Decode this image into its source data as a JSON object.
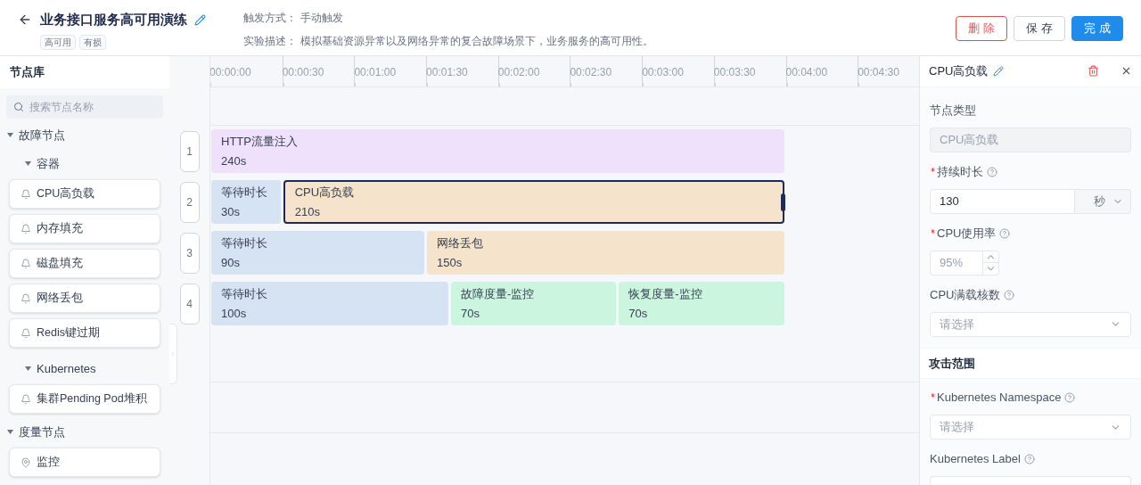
{
  "header": {
    "title": "业务接口服务高可用演练",
    "tags": [
      "高可用",
      "有损"
    ],
    "trigger_label": "触发方式：",
    "trigger": "手动触发",
    "desc_label": "实验描述：",
    "desc": "模拟基础资源异常以及网络异常的复合故障场景下，业务服务的高可用性。",
    "buttons": [
      {
        "label": "删 除",
        "kind": "danger"
      },
      {
        "label": "保 存",
        "kind": "default"
      },
      {
        "label": "完 成",
        "kind": "primary"
      }
    ]
  },
  "library": {
    "title": "节点库",
    "search": {
      "placeholder": "搜索节点名称"
    },
    "groups": [
      {
        "label": "故障节点",
        "expanded": true,
        "children": [
          {
            "label": "容器",
            "expanded": true,
            "children": [
              {
                "label": "CPU高负载",
                "kind": "fault"
              },
              {
                "label": "内存填充",
                "kind": "fault"
              },
              {
                "label": "磁盘填充",
                "kind": "fault"
              },
              {
                "label": "网络丢包",
                "kind": "fault"
              },
              {
                "label": "Redis键过期",
                "kind": "fault"
              }
            ]
          },
          {
            "label": "Kubernetes",
            "expanded": true,
            "children": [
              {
                "label": "集群Pending Pod堆积",
                "kind": "fault"
              }
            ]
          }
        ]
      },
      {
        "label": "度量节点",
        "expanded": true,
        "children": [
          {
            "label": "监控",
            "kind": "metric"
          }
        ]
      }
    ]
  },
  "timeline": {
    "ticks": [
      "00:00:00",
      "00:00:30",
      "00:01:00",
      "00:01:30",
      "00:02:00",
      "00:02:30",
      "00:03:00",
      "00:03:30",
      "00:04:00",
      "00:04:30"
    ],
    "lanes": [
      {
        "number": "1",
        "blocks": [
          {
            "name": "HTTP流量注入",
            "duration": "240s",
            "color": "#efe1fb",
            "selected": false
          }
        ]
      },
      {
        "number": "2",
        "blocks": [
          {
            "name": "等待时长",
            "duration": "30s",
            "color": "#d5e3f2",
            "selected": false
          },
          {
            "name": "CPU高负载",
            "duration": "210s",
            "color": "#f6e3cc",
            "selected": true
          }
        ]
      },
      {
        "number": "3",
        "blocks": [
          {
            "name": "等待时长",
            "duration": "90s",
            "color": "#d5e3f2",
            "selected": false
          },
          {
            "name": "网络丢包",
            "duration": "150s",
            "color": "#f6e3cc",
            "selected": false
          }
        ]
      },
      {
        "number": "4",
        "blocks": [
          {
            "name": "等待时长",
            "duration": "100s",
            "color": "#d5e3f2",
            "selected": false
          },
          {
            "name": "故障度量-监控",
            "duration": "70s",
            "color": "#ccf5e0",
            "selected": false
          },
          {
            "name": "恢复度量-监控",
            "duration": "70s",
            "color": "#ccf5e0",
            "selected": false
          }
        ]
      }
    ]
  },
  "panel": {
    "title": "CPU高负载",
    "fields": [
      {
        "kind": "disabled",
        "label": "节点类型",
        "required": false,
        "help": false,
        "value": "CPU高负载"
      },
      {
        "kind": "unit",
        "label": "持续时长",
        "required": true,
        "help": true,
        "value": "130",
        "unit": "秒"
      },
      {
        "kind": "number",
        "label": "CPU使用率",
        "required": true,
        "help": true,
        "placeholder": "95%"
      },
      {
        "kind": "select",
        "label": "CPU满载核数",
        "required": false,
        "help": true,
        "placeholder": "请选择"
      }
    ],
    "section": "攻击范围",
    "fields2": [
      {
        "kind": "select",
        "label": "Kubernetes Namespace",
        "required": true,
        "help": true,
        "placeholder": "请选择"
      },
      {
        "kind": "cut",
        "label": "Kubernetes Label",
        "required": false,
        "help": true
      }
    ]
  }
}
